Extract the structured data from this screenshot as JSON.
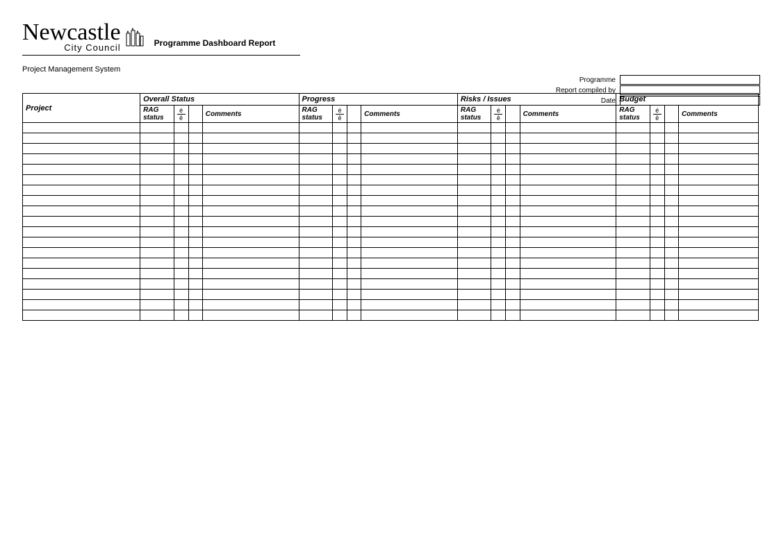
{
  "header": {
    "org_name": "Newcastle",
    "org_sub": "City Council",
    "report_title": "Programme Dashboard Report",
    "system_name": "Project Management System"
  },
  "meta": {
    "programme_label": "Programme",
    "programme_value": "",
    "compiled_label": "Report compiled by",
    "compiled_value": "",
    "date_label": "Date",
    "date_value": ""
  },
  "table": {
    "project_header": "Project",
    "sections": {
      "overall": "Overall Status",
      "progress": "Progress",
      "risks": "Risks / Issues",
      "budget": "Budget"
    },
    "subheaders": {
      "rag": "RAG status",
      "up": "é",
      "down": "ê",
      "comments": "Comments"
    },
    "row_count": 19
  }
}
